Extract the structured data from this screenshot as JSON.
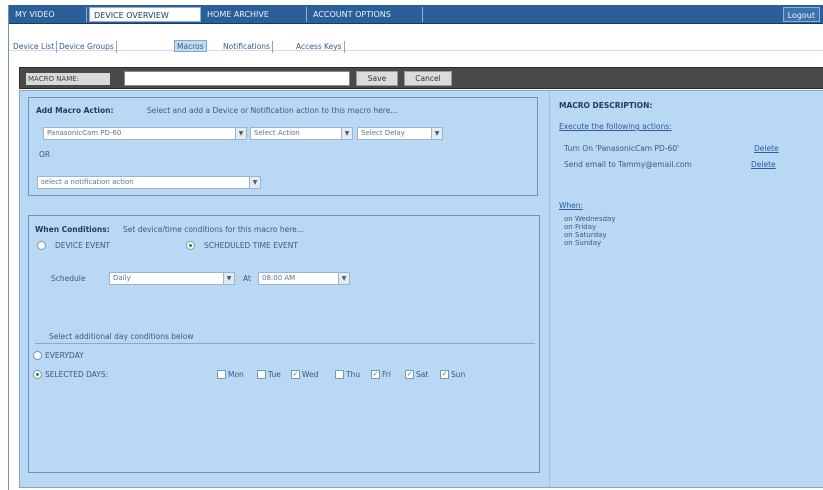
{
  "topnav": {
    "tabs": [
      {
        "label": "MY VIDEO"
      },
      {
        "label": "DEVICE OVERVIEW"
      },
      {
        "label": "HOME ARCHIVE"
      },
      {
        "label": "ACCOUNT OPTIONS"
      }
    ],
    "logout": "Logout"
  },
  "subnav": {
    "tabs": [
      {
        "label": "Device List"
      },
      {
        "label": "Device Groups"
      },
      {
        "label": "Macros"
      },
      {
        "label": "Notifications"
      },
      {
        "label": "Access Keys"
      }
    ]
  },
  "namebar": {
    "label": "MACRO NAME:",
    "input_value": "",
    "save": "Save",
    "cancel": "Cancel"
  },
  "actions": {
    "title": "Add Macro Action:",
    "instructions": "Select and add a Device or Notification action to this macro here...",
    "device_select": "PanasonicCam PD-60",
    "action_select": "Select Action",
    "delay_select": "Select Delay",
    "or_label": "OR",
    "notification_select": "select a notification action"
  },
  "conditions": {
    "title": "When Conditions:",
    "instructions": "Set device/time conditions for this macro here...",
    "device_event": "DEVICE EVENT",
    "scheduled_event": "SCHEDULED TIME EVENT",
    "schedule_label": "Schedule",
    "schedule_value": "Daily",
    "at_label": "At",
    "time_value": "08:00 AM",
    "additional_label": "Select additional day conditions below",
    "everyday": "EVERYDAY",
    "selected_days": "SELECTED DAYS:",
    "days": [
      {
        "label": "Mon",
        "checked": false
      },
      {
        "label": "Tue",
        "checked": false
      },
      {
        "label": "Wed",
        "checked": true
      },
      {
        "label": "Thu",
        "checked": false
      },
      {
        "label": "Fri",
        "checked": true
      },
      {
        "label": "Sat",
        "checked": true
      },
      {
        "label": "Sun",
        "checked": true
      }
    ]
  },
  "description": {
    "title": "MACRO DESCRIPTION:",
    "execute_link": "Execute the following actions:",
    "action1": "Turn On 'PanasonicCam PD-60'",
    "action2": "Send email to Tammy@email.com",
    "delete_label": "Delete",
    "when_title": "When:",
    "when_lines": [
      "on Wednesday",
      "on Friday",
      "on Saturday",
      "on Sunday"
    ]
  }
}
